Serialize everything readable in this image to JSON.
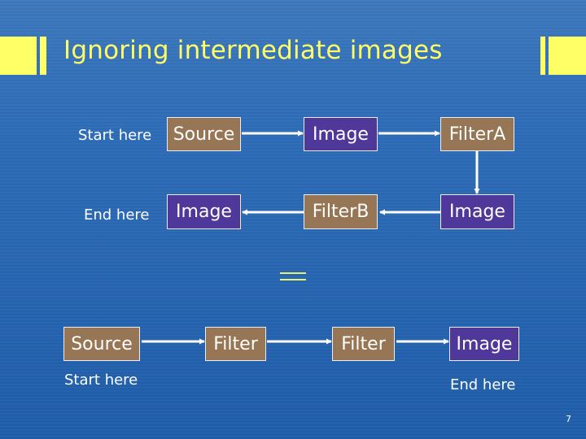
{
  "slide": {
    "title": "Ignoring intermediate images",
    "page_number": "7",
    "colors": {
      "background": "#2d6cb8",
      "accent_yellow": "#ffff66",
      "filter_box": "#967654",
      "image_box": "#50389a",
      "text": "#ffffff"
    }
  },
  "top_diagram": {
    "start_label": "Start here",
    "end_label": "End here",
    "nodes": [
      {
        "id": "source",
        "label": "Source",
        "kind": "filter"
      },
      {
        "id": "image1",
        "label": "Image",
        "kind": "image"
      },
      {
        "id": "filterA",
        "label": "FilterA",
        "kind": "filter"
      },
      {
        "id": "image2",
        "label": "Image",
        "kind": "image"
      },
      {
        "id": "filterB",
        "label": "FilterB",
        "kind": "filter"
      },
      {
        "id": "image3",
        "label": "Image",
        "kind": "image"
      }
    ],
    "edges": [
      [
        "source",
        "image1"
      ],
      [
        "image1",
        "filterA"
      ],
      [
        "filterA",
        "image2"
      ],
      [
        "image2",
        "filterB"
      ],
      [
        "filterB",
        "image3"
      ]
    ]
  },
  "equals_symbol": "=",
  "bottom_diagram": {
    "start_label": "Start here",
    "end_label": "End here",
    "nodes": [
      {
        "id": "source",
        "label": "Source",
        "kind": "filter"
      },
      {
        "id": "filter1",
        "label": "Filter",
        "kind": "filter"
      },
      {
        "id": "filter2",
        "label": "Filter",
        "kind": "filter"
      },
      {
        "id": "image",
        "label": "Image",
        "kind": "image"
      }
    ],
    "edges": [
      [
        "source",
        "filter1"
      ],
      [
        "filter1",
        "filter2"
      ],
      [
        "filter2",
        "image"
      ]
    ]
  }
}
